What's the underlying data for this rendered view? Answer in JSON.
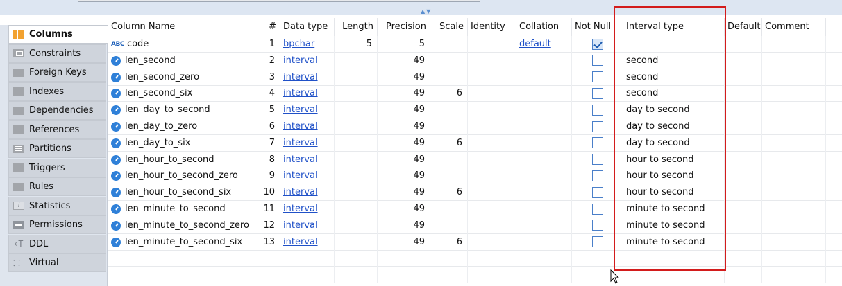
{
  "sidebar": {
    "items": [
      {
        "label": "Columns",
        "icon": "columns-icon",
        "active": true
      },
      {
        "label": "Constraints",
        "icon": "constraints-icon"
      },
      {
        "label": "Foreign Keys",
        "icon": "folder-icon"
      },
      {
        "label": "Indexes",
        "icon": "folder-icon"
      },
      {
        "label": "Dependencies",
        "icon": "folder-icon"
      },
      {
        "label": "References",
        "icon": "folder-icon"
      },
      {
        "label": "Partitions",
        "icon": "partitions-icon"
      },
      {
        "label": "Triggers",
        "icon": "folder-icon"
      },
      {
        "label": "Rules",
        "icon": "folder-icon"
      },
      {
        "label": "Statistics",
        "icon": "statistics-icon"
      },
      {
        "label": "Permissions",
        "icon": "permissions-icon"
      },
      {
        "label": "DDL",
        "icon": "ddl-icon"
      },
      {
        "label": "Virtual",
        "icon": "virtual-icon"
      }
    ]
  },
  "table": {
    "headers": {
      "column_name": "Column Name",
      "num": "#",
      "data_type": "Data type",
      "length": "Length",
      "precision": "Precision",
      "scale": "Scale",
      "identity": "Identity",
      "collation": "Collation",
      "not_null": "Not Null",
      "interval_type": "Interval type",
      "default": "Default",
      "comment": "Comment"
    },
    "rows": [
      {
        "name": "code",
        "num": "1",
        "type": "bpchar",
        "length": "5",
        "precision": "5",
        "scale": "",
        "collation": "default",
        "not_null": true,
        "interval": "",
        "icon": "text-type-icon"
      },
      {
        "name": "len_second",
        "num": "2",
        "type": "interval",
        "length": "",
        "precision": "49",
        "scale": "",
        "collation": "",
        "not_null": false,
        "interval": "second",
        "icon": "clock-icon"
      },
      {
        "name": "len_second_zero",
        "num": "3",
        "type": "interval",
        "length": "",
        "precision": "49",
        "scale": "",
        "collation": "",
        "not_null": false,
        "interval": "second",
        "icon": "clock-icon"
      },
      {
        "name": "len_second_six",
        "num": "4",
        "type": "interval",
        "length": "",
        "precision": "49",
        "scale": "6",
        "collation": "",
        "not_null": false,
        "interval": "second",
        "icon": "clock-icon"
      },
      {
        "name": "len_day_to_second",
        "num": "5",
        "type": "interval",
        "length": "",
        "precision": "49",
        "scale": "",
        "collation": "",
        "not_null": false,
        "interval": "day to second",
        "icon": "clock-icon"
      },
      {
        "name": "len_day_to_zero",
        "num": "6",
        "type": "interval",
        "length": "",
        "precision": "49",
        "scale": "",
        "collation": "",
        "not_null": false,
        "interval": "day to second",
        "icon": "clock-icon"
      },
      {
        "name": "len_day_to_six",
        "num": "7",
        "type": "interval",
        "length": "",
        "precision": "49",
        "scale": "6",
        "collation": "",
        "not_null": false,
        "interval": "day to second",
        "icon": "clock-icon"
      },
      {
        "name": "len_hour_to_second",
        "num": "8",
        "type": "interval",
        "length": "",
        "precision": "49",
        "scale": "",
        "collation": "",
        "not_null": false,
        "interval": "hour to second",
        "icon": "clock-icon"
      },
      {
        "name": "len_hour_to_second_zero",
        "num": "9",
        "type": "interval",
        "length": "",
        "precision": "49",
        "scale": "",
        "collation": "",
        "not_null": false,
        "interval": "hour to second",
        "icon": "clock-icon"
      },
      {
        "name": "len_hour_to_second_six",
        "num": "10",
        "type": "interval",
        "length": "",
        "precision": "49",
        "scale": "6",
        "collation": "",
        "not_null": false,
        "interval": "hour to second",
        "icon": "clock-icon"
      },
      {
        "name": "len_minute_to_second",
        "num": "11",
        "type": "interval",
        "length": "",
        "precision": "49",
        "scale": "",
        "collation": "",
        "not_null": false,
        "interval": "minute to second",
        "icon": "clock-icon"
      },
      {
        "name": "len_minute_to_second_zero",
        "num": "12",
        "type": "interval",
        "length": "",
        "precision": "49",
        "scale": "",
        "collation": "",
        "not_null": false,
        "interval": "minute to second",
        "icon": "clock-icon"
      },
      {
        "name": "len_minute_to_second_six",
        "num": "13",
        "type": "interval",
        "length": "",
        "precision": "49",
        "scale": "6",
        "collation": "",
        "not_null": false,
        "interval": "minute to second",
        "icon": "clock-icon"
      }
    ]
  },
  "colors": {
    "highlight": "#d31c1c",
    "link": "#2051c8",
    "sidebar_bg": "#dfe5ee",
    "column_icon": "#f2a230"
  }
}
